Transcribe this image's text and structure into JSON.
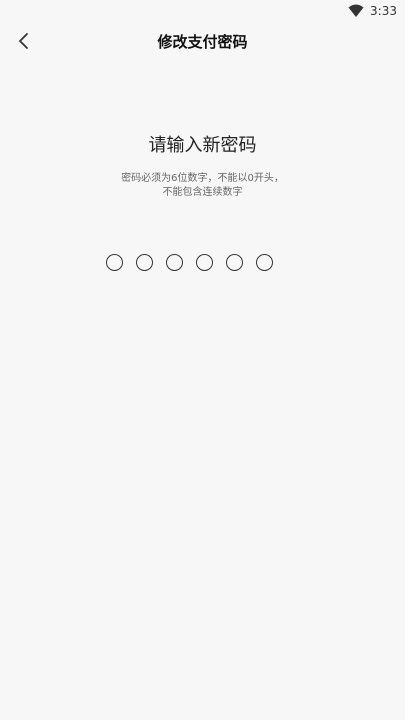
{
  "status_bar": {
    "time": "3:33",
    "wifi_icon": "wifi-icon"
  },
  "header": {
    "back_icon": "chevron-left-icon",
    "title": "修改支付密码"
  },
  "prompt": {
    "title": "请输入新密码",
    "hint_line1": "密码必须为6位数字，不能以0开头，",
    "hint_line2": "不能包含连续数字"
  },
  "pin": {
    "length": 6,
    "filled": 0
  }
}
